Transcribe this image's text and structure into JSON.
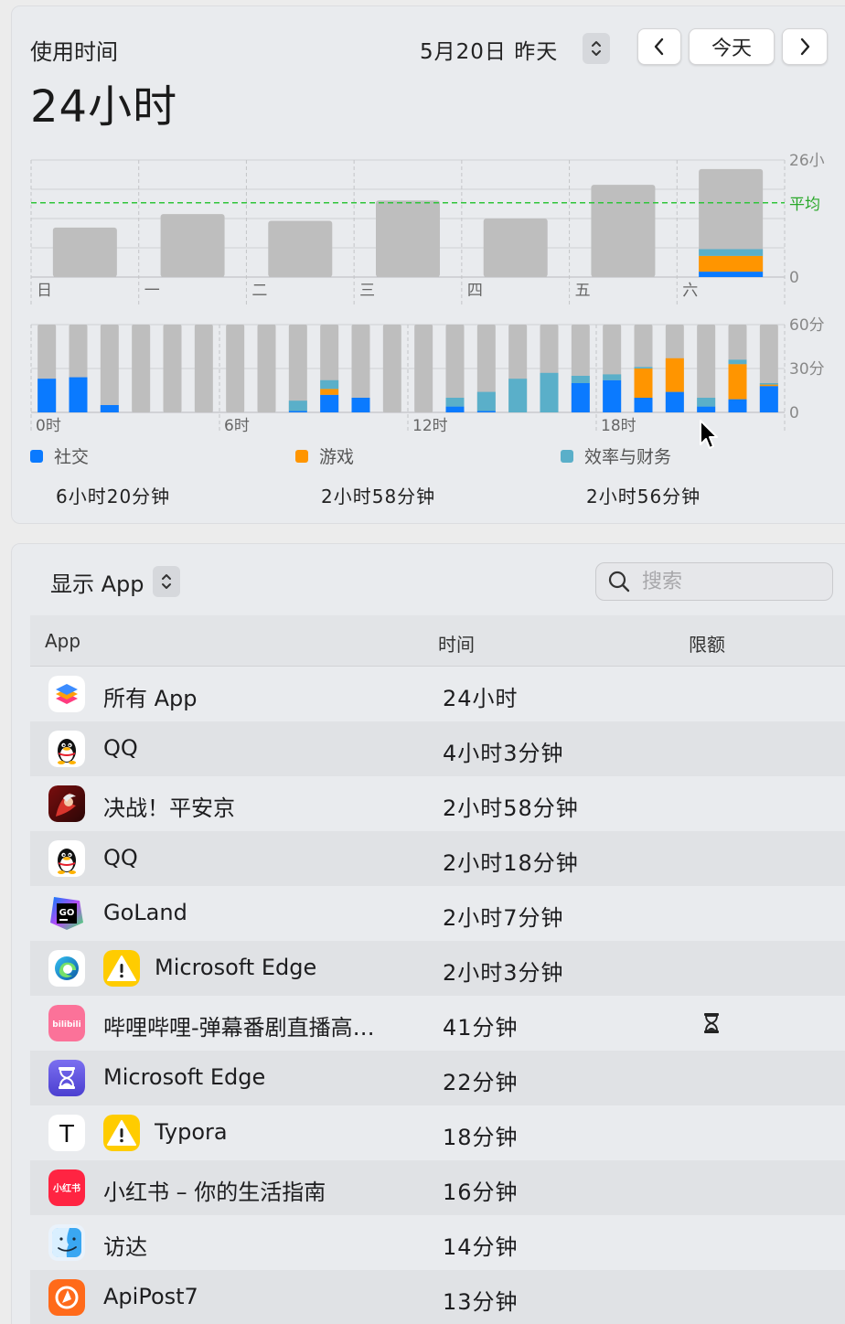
{
  "header": {
    "usage_label": "使用时间",
    "usage_total": "24小时",
    "date_label": "5月20日 昨天",
    "prev_icon": "chevron-left",
    "today_label": "今天",
    "next_icon": "chevron-right"
  },
  "colors": {
    "social": "#0a7aff",
    "games": "#ff9500",
    "productivity": "#5aafc9",
    "other": "#bebebe",
    "average_line": "#2fc43a",
    "average_text": "#28a828"
  },
  "weekly_chart": {
    "type": "bar",
    "categories": [
      "日",
      "一",
      "二",
      "三",
      "四",
      "五",
      "六"
    ],
    "ylim": [
      0,
      26
    ],
    "y_ticks": [
      "0",
      "26小"
    ],
    "average_label": "平均",
    "average_value": 16.5,
    "bars": [
      {
        "total": 11.0
      },
      {
        "total": 14.0
      },
      {
        "total": 12.5
      },
      {
        "total": 17.0
      },
      {
        "total": 13.0
      },
      {
        "total": 20.5
      },
      {
        "total": 24.0,
        "social": 1.2,
        "games": 3.5,
        "productivity": 1.5
      }
    ],
    "selected_index": 6
  },
  "hourly_chart": {
    "type": "bar",
    "ylim": [
      0,
      60
    ],
    "y_ticks": [
      "0",
      "30分",
      "60分"
    ],
    "x_ticks": [
      "0时",
      "6时",
      "12时",
      "18时"
    ],
    "hours": [
      {
        "social": 23,
        "games": 0,
        "productivity": 0,
        "total": 60
      },
      {
        "social": 24,
        "games": 0,
        "productivity": 0,
        "total": 60
      },
      {
        "social": 5,
        "games": 0,
        "productivity": 0,
        "total": 60
      },
      {
        "social": 0,
        "games": 0,
        "productivity": 0,
        "total": 60
      },
      {
        "social": 0,
        "games": 0,
        "productivity": 0,
        "total": 60
      },
      {
        "social": 0,
        "games": 0,
        "productivity": 0,
        "total": 60
      },
      {
        "social": 0,
        "games": 0,
        "productivity": 0,
        "total": 60
      },
      {
        "social": 0,
        "games": 0,
        "productivity": 0,
        "total": 60
      },
      {
        "social": 1,
        "games": 0,
        "productivity": 7,
        "total": 60
      },
      {
        "social": 12,
        "games": 4,
        "productivity": 6,
        "total": 60
      },
      {
        "social": 10,
        "games": 0,
        "productivity": 0,
        "total": 60
      },
      {
        "social": 0,
        "games": 0,
        "productivity": 0,
        "total": 60
      },
      {
        "social": 0,
        "games": 0,
        "productivity": 0,
        "total": 60
      },
      {
        "social": 4,
        "games": 0,
        "productivity": 6,
        "total": 60
      },
      {
        "social": 1,
        "games": 0,
        "productivity": 13,
        "total": 60
      },
      {
        "social": 0,
        "games": 0,
        "productivity": 23,
        "total": 60
      },
      {
        "social": 0,
        "games": 0,
        "productivity": 27,
        "total": 60
      },
      {
        "social": 20,
        "games": 0,
        "productivity": 5,
        "total": 60
      },
      {
        "social": 22,
        "games": 0,
        "productivity": 4,
        "total": 60
      },
      {
        "social": 10,
        "games": 20,
        "productivity": 1,
        "total": 60
      },
      {
        "social": 14,
        "games": 23,
        "productivity": 0,
        "total": 60
      },
      {
        "social": 4,
        "games": 0,
        "productivity": 6,
        "total": 60
      },
      {
        "social": 9,
        "games": 24,
        "productivity": 3,
        "total": 60
      },
      {
        "social": 18,
        "games": 1,
        "productivity": 1,
        "total": 60
      }
    ]
  },
  "legend": [
    {
      "label": "社交",
      "value": "6小时20分钟",
      "color": "#0a7aff"
    },
    {
      "label": "游戏",
      "value": "2小时58分钟",
      "color": "#ff9500"
    },
    {
      "label": "效率与财务",
      "value": "2小时56分钟",
      "color": "#5aafc9"
    }
  ],
  "apps_panel": {
    "show_label": "显示 App",
    "search_placeholder": "搜索",
    "columns": {
      "app": "App",
      "time": "时间",
      "limit": "限额"
    },
    "rows": [
      {
        "name": "所有 App",
        "time": "24小时",
        "icon": "all-apps-icon",
        "warn": false,
        "limit": false
      },
      {
        "name": "QQ",
        "time": "4小时3分钟",
        "icon": "qq-icon",
        "warn": false,
        "limit": false
      },
      {
        "name": "决战！平安京",
        "time": "2小时58分钟",
        "icon": "onmyoji-arena-icon",
        "warn": false,
        "limit": false
      },
      {
        "name": "QQ",
        "time": "2小时18分钟",
        "icon": "qq-icon",
        "warn": false,
        "limit": false
      },
      {
        "name": "GoLand",
        "time": "2小时7分钟",
        "icon": "goland-icon",
        "warn": false,
        "limit": false
      },
      {
        "name": "Microsoft Edge",
        "time": "2小时3分钟",
        "icon": "edge-icon",
        "warn": true,
        "limit": false
      },
      {
        "name": "哔哩哔哩-弹幕番剧直播高清视频",
        "time": "41分钟",
        "icon": "bilibili-icon",
        "warn": false,
        "limit": true
      },
      {
        "name": "Microsoft Edge",
        "time": "22分钟",
        "icon": "hourglass-app-icon",
        "warn": false,
        "limit": false
      },
      {
        "name": "Typora",
        "time": "18分钟",
        "icon": "typora-icon",
        "warn": true,
        "limit": false
      },
      {
        "name": "小红书 – 你的生活指南",
        "time": "16分钟",
        "icon": "xiaohongshu-icon",
        "warn": false,
        "limit": false
      },
      {
        "name": "访达",
        "time": "14分钟",
        "icon": "finder-icon",
        "warn": false,
        "limit": false
      },
      {
        "name": "ApiPost7",
        "time": "13分钟",
        "icon": "apipost-icon",
        "warn": false,
        "limit": false
      }
    ],
    "icon_text": {
      "goland": "GO",
      "bilibili": "bilibili",
      "typora": "T",
      "xiaohongshu": "小红书"
    }
  }
}
